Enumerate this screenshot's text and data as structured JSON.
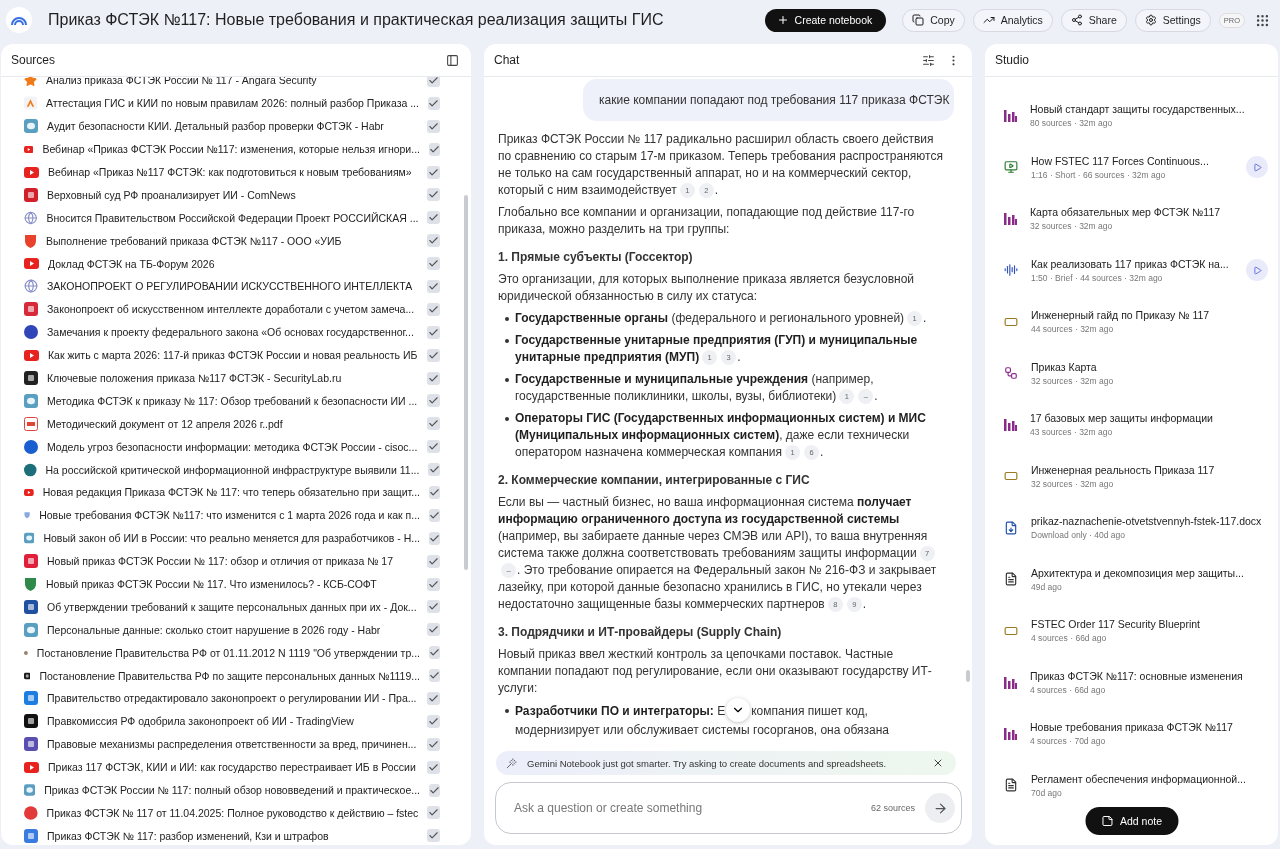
{
  "header": {
    "title": "Приказ ФСТЭК №117: Новые требования и практическая реализация защиты ГИС",
    "actions": [
      {
        "kind": "create",
        "label": "Create notebook"
      },
      {
        "kind": "copy",
        "label": "Copy"
      },
      {
        "kind": "analytics",
        "label": "Analytics"
      },
      {
        "kind": "share",
        "label": "Share"
      },
      {
        "kind": "settings",
        "label": "Settings"
      }
    ],
    "badge": "PRO"
  },
  "sources": {
    "title": "Sources",
    "items": [
      {
        "kind": "star",
        "title": "Анализ приказа ФСТЭК России № 117 - Angara Security",
        "checked": true
      },
      {
        "kind": "triangle",
        "title": "Аттестация ГИС и КИИ по новым правилам 2026: полный разбор Приказа ...",
        "checked": true
      },
      {
        "kind": "bubble",
        "title": "Аудит безопасности КИИ. Детальный разбор проверки ФСТЭК - Habr",
        "checked": true
      },
      {
        "kind": "video",
        "title": "Вебинар «Приказ ФСТЭК России №117: изменения, которые нельзя игнори...",
        "checked": true
      },
      {
        "kind": "video",
        "title": "Вебинар «Приказ №117 ФСТЭК: как подготовиться к новым требованиям»",
        "checked": true
      },
      {
        "kind": "square",
        "color": "#d0202a",
        "title": "Верховный суд РФ проанализирует ИИ - ComNews",
        "checked": true
      },
      {
        "kind": "globe",
        "title": "Вносится Правительством Российской Федерации Проект РОССИЙСКАЯ ...",
        "checked": true
      },
      {
        "kind": "shield",
        "color": "#e8412c",
        "title": "Выполнение требований приказа ФСТЭК №117 - ООО «УИБ",
        "checked": true
      },
      {
        "kind": "video",
        "title": "Доклад ФСТЭК на ТБ-Форум 2026",
        "checked": true
      },
      {
        "kind": "globe",
        "title": "ЗАКОНОПРОЕКТ О РЕГУЛИРОВАНИИ ИСКУССТВЕННОГО ИНТЕЛЛЕКТА",
        "checked": true
      },
      {
        "kind": "square",
        "color": "#d6293a",
        "title": "Законопроект об искусственном интеллекте доработали с учетом замеча...",
        "checked": true
      },
      {
        "kind": "circle",
        "color": "#3046b8",
        "title": "Замечания к проекту федерального закона «Об основах государственног...",
        "checked": true
      },
      {
        "kind": "video",
        "title": "Как жить с марта 2026: 117-й приказ ФСТЭК России и новая реальность ИБ",
        "checked": true
      },
      {
        "kind": "square",
        "color": "#222222",
        "title": "Ключевые положения приказа №117 ФСТЭК - SecurityLab.ru",
        "checked": true
      },
      {
        "kind": "bubble",
        "title": "Методика ФСТЭК к приказу № 117: Обзор требований к безопасности ИИ ...",
        "checked": true
      },
      {
        "kind": "pdf",
        "title": "Методический документ от 12 апреля 2026 г..pdf",
        "checked": true
      },
      {
        "kind": "circle",
        "color": "#1a5fd0",
        "title": "Модель угроз безопасности информации: методика ФСТЭК России - cisoc...",
        "checked": true
      },
      {
        "kind": "circle",
        "color": "#1b6e7a",
        "title": "На российской критической информационной инфраструктуре выявили 11...",
        "checked": true
      },
      {
        "kind": "video",
        "title": "Новая редакция Приказа ФСТЭК № 117: что теперь обязательно при защит...",
        "checked": true
      },
      {
        "kind": "shield",
        "color": "#8aa8e0",
        "title": "Новые требования ФСТЭК №117: что изменится с 1 марта 2026 года и как п...",
        "checked": true
      },
      {
        "kind": "bubble",
        "title": "Новый закон об ИИ в России: что реально меняется для разработчиков - Н...",
        "checked": true
      },
      {
        "kind": "square",
        "color": "#e0203a",
        "title": "Новый приказ ФСТЭК России № 117: обзор и отличия от приказа № 17",
        "checked": true
      },
      {
        "kind": "shield",
        "color": "#2f8a4a",
        "title": "Новый приказ ФСТЭК России № 117. Что изменилось? - КСБ-СОФТ",
        "checked": true
      },
      {
        "kind": "square",
        "color": "#2050a0",
        "title": "Об утверждении требований к защите персональных данных при их - Док...",
        "checked": true
      },
      {
        "kind": "bubble",
        "title": "Персональные данные: сколько стоит нарушение в 2026 году - Habr",
        "checked": true
      },
      {
        "kind": "circle",
        "color": "#9a8070",
        "title": "Постановление Правительства РФ от 01.11.2012 N 1119 \"Об утверждении тр...",
        "checked": true
      },
      {
        "kind": "square",
        "color": "#1a1a1a",
        "title": "Постановление Правительства РФ по защите персональных данных №1119...",
        "checked": true
      },
      {
        "kind": "square",
        "color": "#1e7de0",
        "title": "Правительство отредактировало законопроект о регулировании ИИ - Пра...",
        "checked": true
      },
      {
        "kind": "square",
        "color": "#111111",
        "title": "Правкомиссия РФ одобрила законопроект об ИИ - TradingView",
        "checked": true
      },
      {
        "kind": "square",
        "color": "#5a4fb0",
        "title": "Правовые механизмы распределения ответственности за вред, причинен...",
        "checked": true
      },
      {
        "kind": "video",
        "title": "Приказ 117 ФСТЭК, КИИ и ИИ: как государство перестраивает ИБ в России",
        "checked": true
      },
      {
        "kind": "bubble",
        "title": "Приказ ФСТЭК России № 117: полный обзор нововведений и практическое...",
        "checked": true
      },
      {
        "kind": "circle",
        "color": "#e23a3a",
        "title": "Приказ ФСТЭК № 117 от 11.04.2025: Полное руководство к действию – fstec",
        "checked": true
      },
      {
        "kind": "square",
        "color": "#3a7be0",
        "title": "Приказ ФСТЭК № 117: разбор изменений, Кзи и штрафов",
        "checked": true
      }
    ]
  },
  "chat": {
    "title": "Chat",
    "question": "какие компании попадают под требования 117 приказа ФСТЭК",
    "blocks": [
      {
        "kind": "paragraph",
        "parts": [
          {
            "kind": "text",
            "text": "Приказ ФСТЭК России № 117 радикально расширил область своего действия по сравнению со старым 17-м приказом. Теперь требования распространяются не только на сам государственный аппарат, но и на коммерческий сектор, который с ним взаимодействует"
          },
          {
            "kind": "cite",
            "label": "1"
          },
          {
            "kind": "cite",
            "label": "2"
          },
          {
            "kind": "text",
            "text": "."
          }
        ]
      },
      {
        "kind": "paragraph",
        "parts": [
          {
            "kind": "text",
            "text": "Глобально все компании и организации, попадающие под действие 117-го приказа, можно разделить на три группы:"
          }
        ]
      },
      {
        "kind": "heading",
        "parts": [
          {
            "kind": "text",
            "text": "1. Прямые субъекты (Госсектор)"
          }
        ]
      },
      {
        "kind": "paragraph",
        "parts": [
          {
            "kind": "text",
            "text": "Это организации, для которых выполнение приказа является безусловной юридической обязанностью в силу их статуса:"
          }
        ]
      },
      {
        "kind": "bullet",
        "parts": [
          {
            "kind": "text",
            "text": "**Государственные органы** (федерального и регионального уровней)"
          },
          {
            "kind": "cite",
            "label": "1"
          },
          {
            "kind": "text",
            "text": "."
          }
        ]
      },
      {
        "kind": "bullet",
        "parts": [
          {
            "kind": "text",
            "text": "**Государственные унитарные предприятия (ГУП) и муниципальные унитарные предприятия (МУП)**"
          },
          {
            "kind": "cite",
            "label": "1"
          },
          {
            "kind": "cite",
            "label": "3"
          },
          {
            "kind": "text",
            "text": "."
          }
        ]
      },
      {
        "kind": "bullet",
        "parts": [
          {
            "kind": "text",
            "text": "**Государственные и муниципальные учреждения** (например, государственные поликлиники, школы, вузы, библиотеки)"
          },
          {
            "kind": "cite",
            "label": "1"
          },
          {
            "kind": "cite",
            "label": "–"
          },
          {
            "kind": "text",
            "text": "."
          }
        ]
      },
      {
        "kind": "bullet",
        "parts": [
          {
            "kind": "text",
            "text": "**Операторы ГИС (Государственных информационных систем) и МИС (Муниципальных информационных систем)**, даже если технически оператором назначена коммерческая компания"
          },
          {
            "kind": "cite",
            "label": "1"
          },
          {
            "kind": "cite",
            "label": "6"
          },
          {
            "kind": "text",
            "text": "."
          }
        ]
      },
      {
        "kind": "heading",
        "parts": [
          {
            "kind": "text",
            "text": "2. Коммерческие компании, интегрированные с ГИС"
          }
        ]
      },
      {
        "kind": "paragraph",
        "parts": [
          {
            "kind": "text",
            "text": "Если вы — частный бизнес, но ваша информационная система **получает информацию ограниченного доступа из государственной системы** (например, вы забираете данные через СМЭВ или API), то ваша внутренняя система также должна соответствовать требованиям защиты информации"
          },
          {
            "kind": "cite",
            "label": "7"
          },
          {
            "kind": "cite",
            "label": "–"
          },
          {
            "kind": "text",
            "text": ". Это требование опирается на Федеральный закон № 216-ФЗ и закрывает лазейку, при которой данные безопасно хранились в ГИС, но утекали через недостаточно защищенные базы коммерческих партнеров"
          },
          {
            "kind": "cite",
            "label": "8"
          },
          {
            "kind": "cite",
            "label": "9"
          },
          {
            "kind": "text",
            "text": "."
          }
        ]
      },
      {
        "kind": "heading",
        "parts": [
          {
            "kind": "text",
            "text": "3. Подрядчики и ИТ-провайдеры (Supply Chain)"
          }
        ]
      },
      {
        "kind": "paragraph",
        "parts": [
          {
            "kind": "text",
            "text": "Новый приказ ввел жесткий контроль за цепочками поставок. Частные компании попадают под регулирование, если они оказывают государству ИТ-услуги:"
          }
        ]
      },
      {
        "kind": "bullet",
        "parts": [
          {
            "kind": "text",
            "text": "**Разработчики ПО и интеграторы:** Е"
          },
          {
            "kind": "scroll_button"
          },
          {
            "kind": "text",
            "text": "компания пишет код, модернизирует или обслуживает системы госорганов, она обязана"
          }
        ]
      }
    ],
    "banner": "Gemini Notebook just got smarter. Try asking to create documents and spreadsheets.",
    "input": {
      "placeholder": "Ask a question or create something",
      "count": "62 sources"
    }
  },
  "studio": {
    "title": "Studio",
    "items": [
      {
        "kind": "report",
        "title": "Новый стандарт защиты государственных...",
        "meta": "80 sources · 32m ago",
        "playable": false
      },
      {
        "kind": "video",
        "title": "How FSTEC 117 Forces Continuous...",
        "meta": "1:16 · Short · 66 sources · 32m ago",
        "playable": true
      },
      {
        "kind": "report",
        "title": "Карта обязательных мер ФСТЭК №117",
        "meta": "32 sources · 32m ago",
        "playable": false
      },
      {
        "kind": "audio",
        "title": "Как реализовать 117 приказ ФСТЭК на...",
        "meta": "1:50 · Brief · 44 sources · 32m ago",
        "playable": true
      },
      {
        "kind": "slides",
        "title": "Инженерный гайд по Приказу № 117",
        "meta": "44 sources · 32m ago",
        "playable": false
      },
      {
        "kind": "mindmap",
        "title": "Приказ Карта",
        "meta": "32 sources · 32m ago",
        "playable": false
      },
      {
        "kind": "report",
        "title": "17 базовых мер защиты информации",
        "meta": "43 sources · 32m ago",
        "playable": false
      },
      {
        "kind": "slides",
        "title": "Инженерная реальность Приказа 117",
        "meta": "32 sources · 32m ago",
        "playable": false
      },
      {
        "kind": "download",
        "title": "prikaz-naznachenie-otvetstvennyh-fstek-117.docx",
        "meta": "Download only · 40d ago",
        "playable": false
      },
      {
        "kind": "note",
        "title": "Архитектура и декомпозиция мер защиты...",
        "meta": "49d ago",
        "playable": false
      },
      {
        "kind": "slides",
        "title": "FSTEC Order 117 Security Blueprint",
        "meta": "4 sources · 66d ago",
        "playable": false
      },
      {
        "kind": "report",
        "title": "Приказ ФСТЭК №117: основные изменения",
        "meta": "4 sources · 66d ago",
        "playable": false
      },
      {
        "kind": "report",
        "title": "Новые требования приказа ФСТЭК №117",
        "meta": "4 sources · 70d ago",
        "playable": false
      },
      {
        "kind": "note",
        "title": "Регламент обеспечения информационной...",
        "meta": "70d ago",
        "playable": false
      }
    ],
    "add_note": "Add note"
  }
}
